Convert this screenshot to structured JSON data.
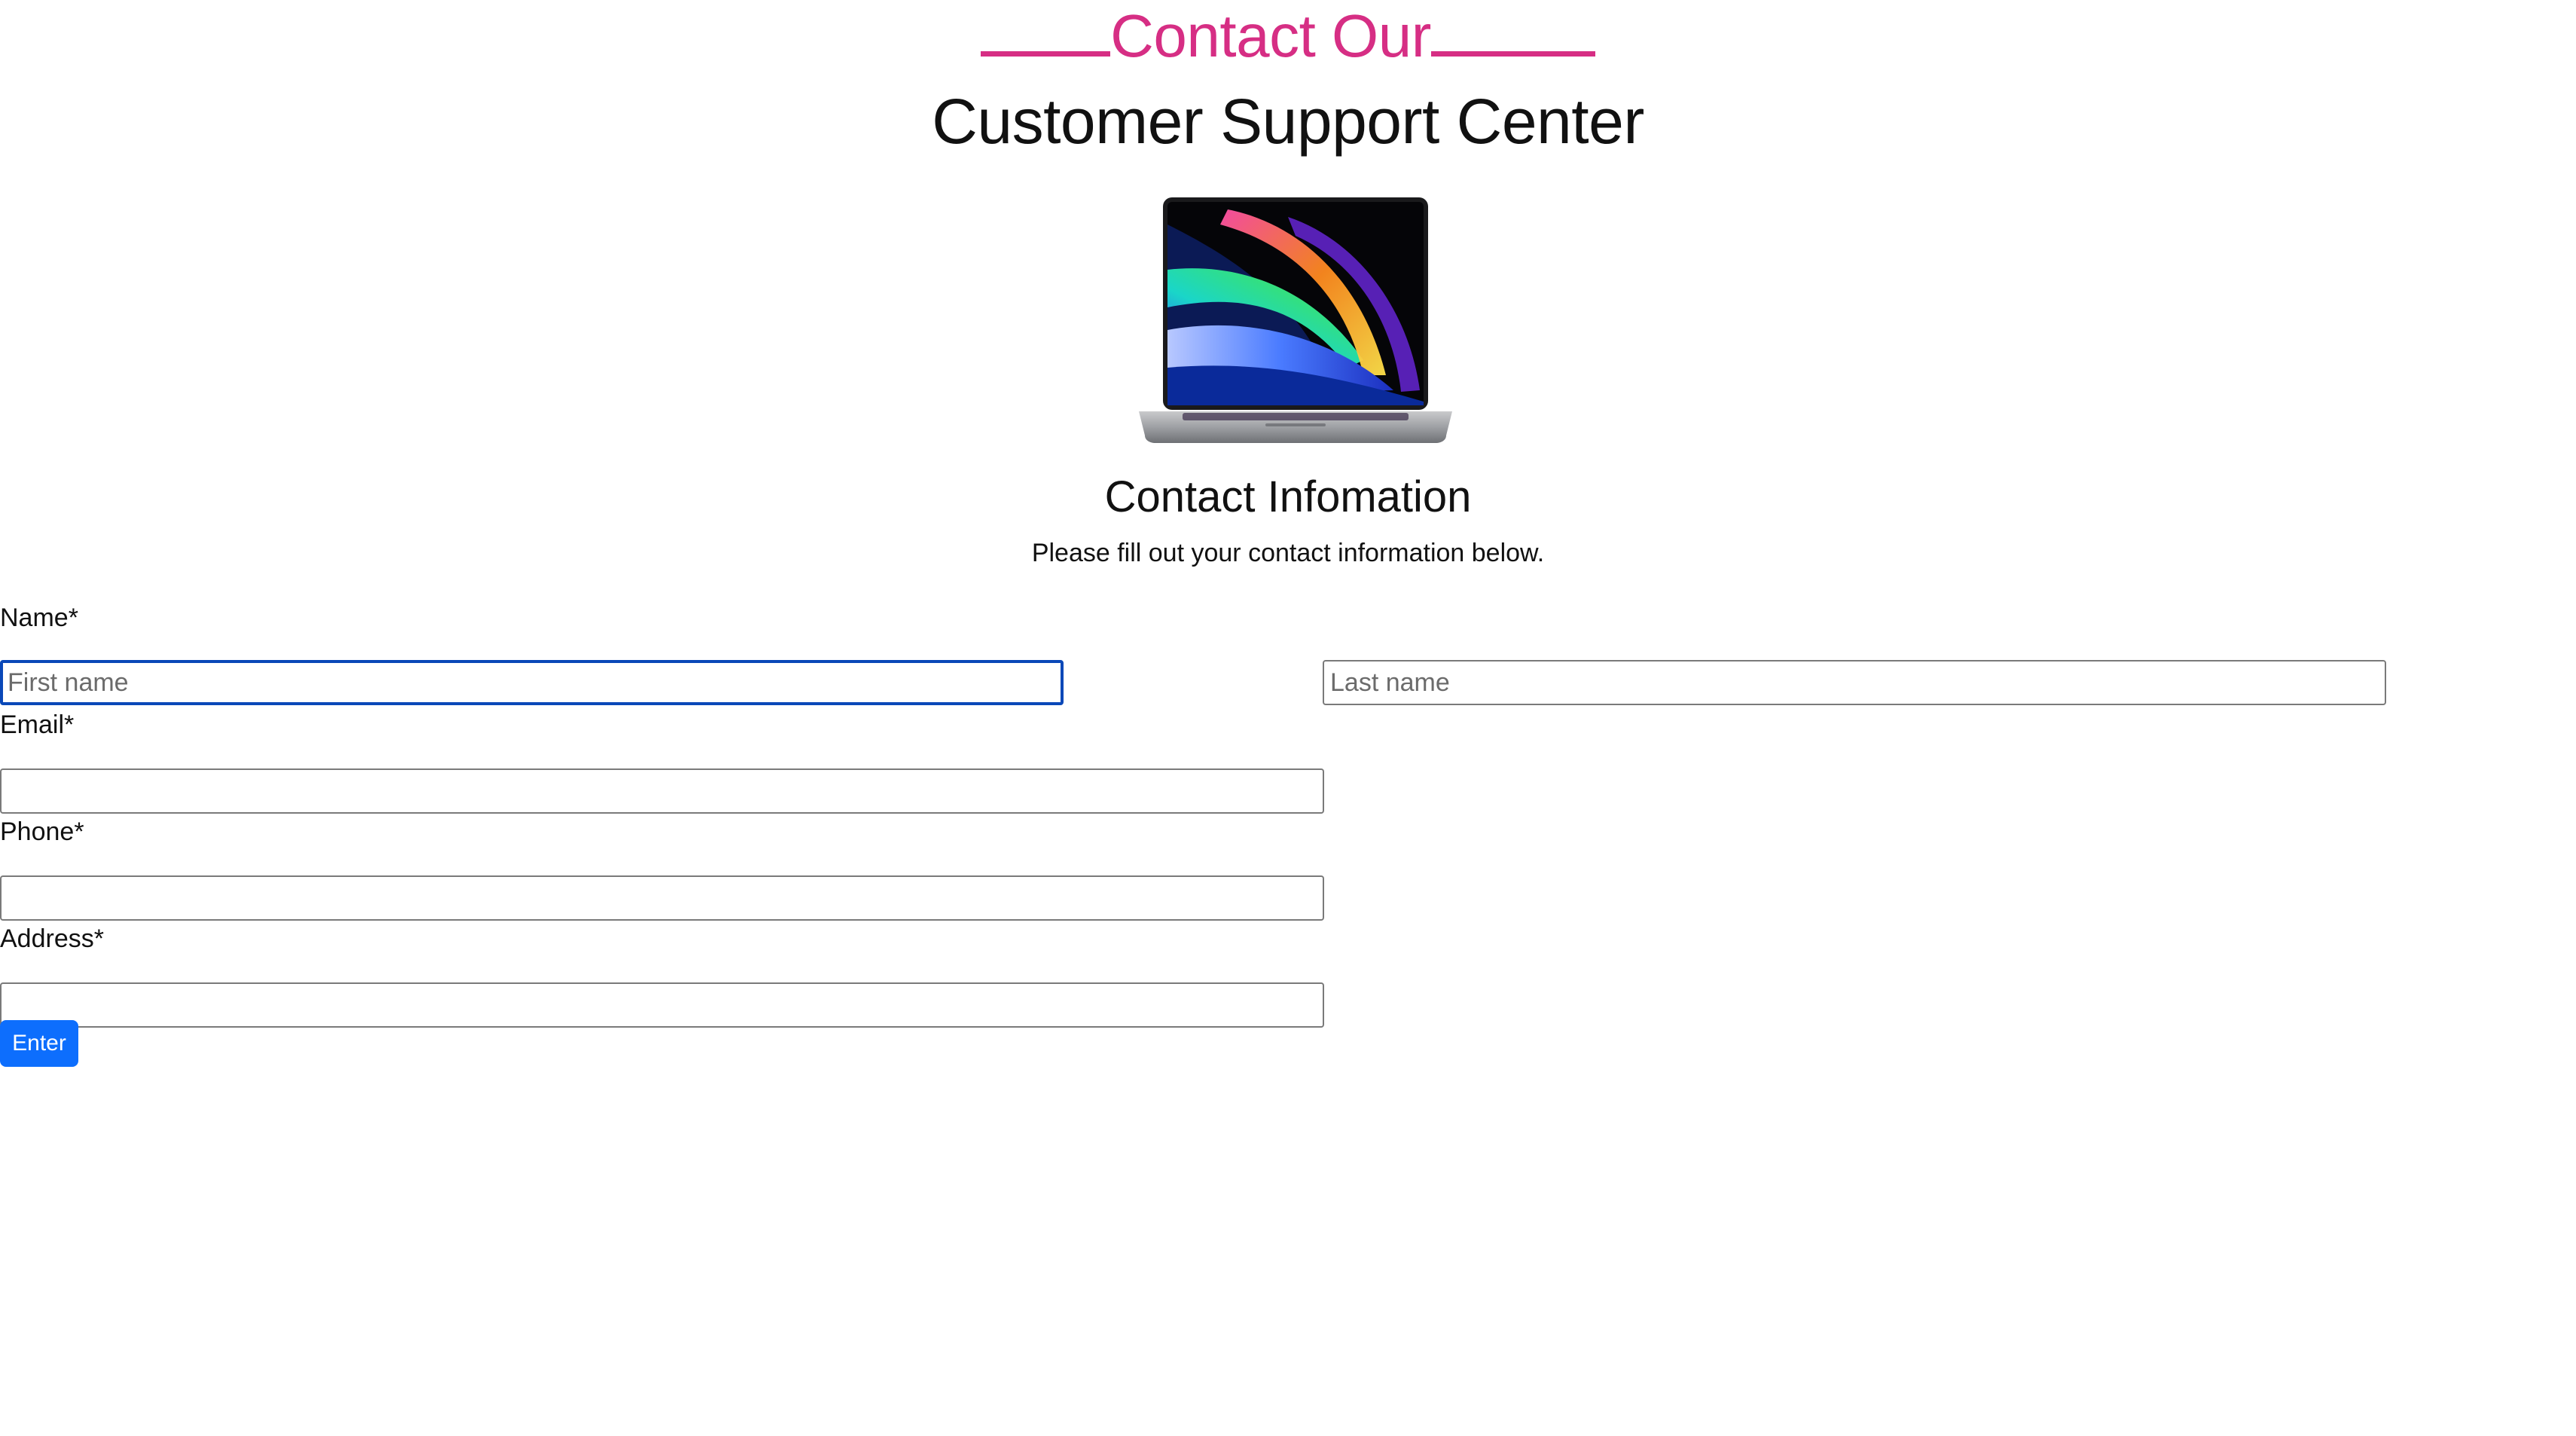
{
  "header": {
    "kicker": "Contact Our",
    "title": "Customer Support Center",
    "accent_color": "#d62e84"
  },
  "hero_image": {
    "alt": "laptop-with-colorful-wallpaper"
  },
  "contact_section": {
    "title": "Contact Infomation",
    "description": "Please fill out your contact information below."
  },
  "form": {
    "name_label": "Name*",
    "first_name_placeholder": "First name",
    "first_name_value": "",
    "last_name_placeholder": "Last name",
    "last_name_value": "",
    "email_label": "Email*",
    "email_value": "",
    "phone_label": "Phone*",
    "phone_value": "",
    "address_label": "Address*",
    "address_value": "",
    "submit_label": "Enter",
    "submit_color": "#0d6efd",
    "focus_color": "#0a48b8"
  }
}
